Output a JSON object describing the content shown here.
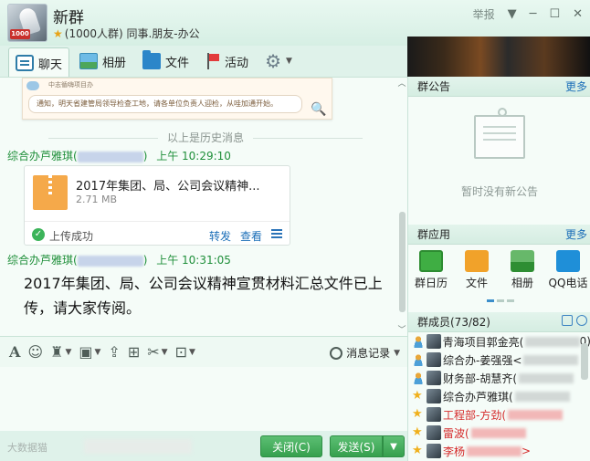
{
  "window": {
    "group_name": "新群",
    "group_info": "(1000人群) 同事.朋友-办公",
    "avatar_badge": "1000",
    "report": "举报"
  },
  "tabs": [
    {
      "label": "聊天"
    },
    {
      "label": "相册"
    },
    {
      "label": "文件"
    },
    {
      "label": "活动"
    }
  ],
  "chat": {
    "notice_image_title": "中志循嗨项目办",
    "notice_image_text": "通知，明天省建管局领导检查工地，请各单位负责人迎检，从哇加通开始。",
    "history_label": "以上是历史消息",
    "messages": [
      {
        "sender": "综合办芦雅琪(",
        "sender_tail": ")",
        "time": "上午 10:29:10",
        "file": {
          "name": "2017年集团、局、公司会议精神...",
          "size": "2.71 MB",
          "status": "上传成功",
          "forward": "转发",
          "view": "查看"
        }
      },
      {
        "sender": "综合办芦雅琪(",
        "sender_tail": ")",
        "time": "上午 10:31:05",
        "text": "2017年集团、局、公司会议精神宣贯材料汇总文件已上传，请大家传阅。"
      }
    ]
  },
  "toolbar": {
    "history": "消息记录"
  },
  "bottom": {
    "logo": "大数据猫",
    "close": "关闭(C)",
    "send": "发送(S)"
  },
  "right": {
    "notice_title": "群公告",
    "more": "更多",
    "no_notice": "暂时没有新公告",
    "apps_title": "群应用",
    "apps": [
      {
        "label": "群日历"
      },
      {
        "label": "文件"
      },
      {
        "label": "相册"
      },
      {
        "label": "QQ电话"
      }
    ],
    "members_title": "群成员(73/82)",
    "members": [
      {
        "name": "青海项目郭金亮(",
        "tail": "0)"
      },
      {
        "name": "综合办-姜强强<",
        "tail": ""
      },
      {
        "name": "财务部-胡慧齐(",
        "tail": ""
      },
      {
        "name": "综合办芦雅琪(",
        "tail": ""
      },
      {
        "name": "工程部-方劲(",
        "tail": ""
      },
      {
        "name": "雷波(",
        "tail": ""
      },
      {
        "name": "李杨",
        "tail": ">"
      }
    ]
  },
  "colors": {
    "accent_green": "#36a04e",
    "sender_green": "#1f8f3a",
    "link_blue": "#1c6fb8",
    "member_red": "#d52a2a"
  }
}
